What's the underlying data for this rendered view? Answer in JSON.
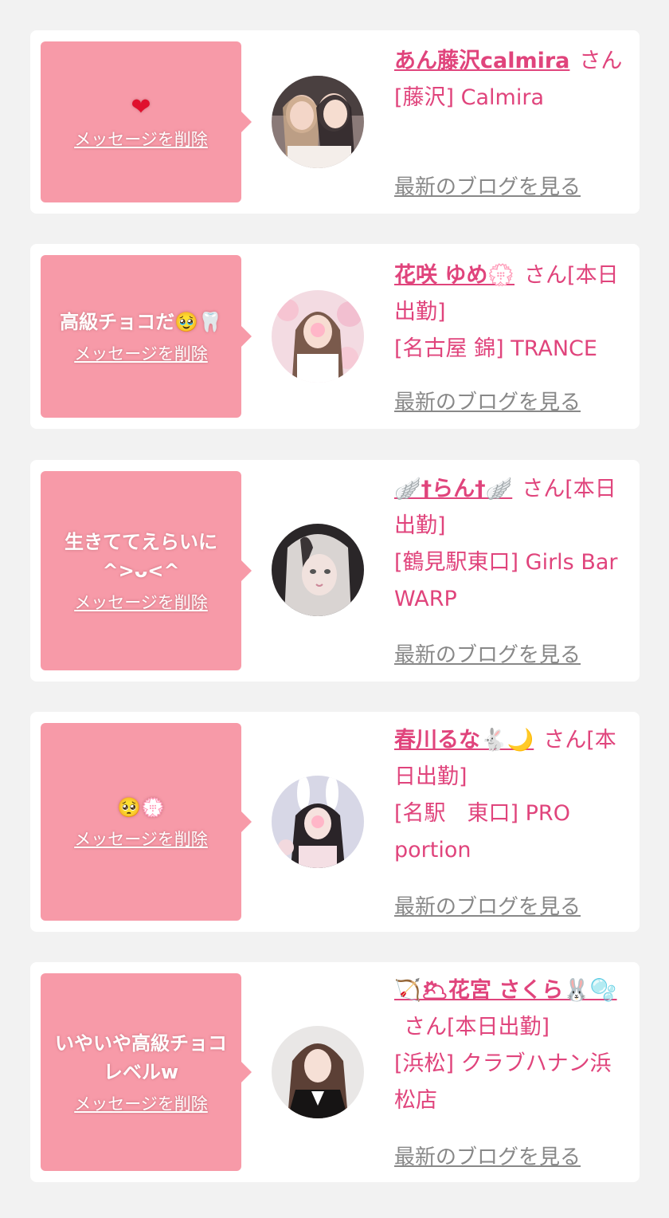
{
  "delete_label": "メッセージを削除",
  "blog_label": "最新のブログを見る",
  "cards": [
    {
      "message": "❤",
      "name": "あん藤沢calmira",
      "suffix": "さん",
      "shop": "[藤沢] Calmira"
    },
    {
      "message": "高級チョコだ🥹🦷",
      "name": "花咲 ゆめ💮",
      "suffix": "さん[本日出勤]",
      "shop": "[名古屋 錦] TRANCE"
    },
    {
      "message": "生きててえらいに^>ᴗ<^",
      "name": "🪽†らん†🪽",
      "suffix": "さん[本日出勤]",
      "shop": "[鶴見駅東口] Girls Bar WARP"
    },
    {
      "message": "🥺💮",
      "name": "春川るな🐇🌙",
      "suffix": "さん[本日出勤]",
      "shop": "[名駅　東口] PRO portion"
    },
    {
      "message": "いやいや高級チョコレベルw",
      "name": "🏹🌥花宮 さくら🐰🫧",
      "suffix": "さん[本日出勤]",
      "shop": "[浜松] クラブハナン浜松店"
    }
  ]
}
